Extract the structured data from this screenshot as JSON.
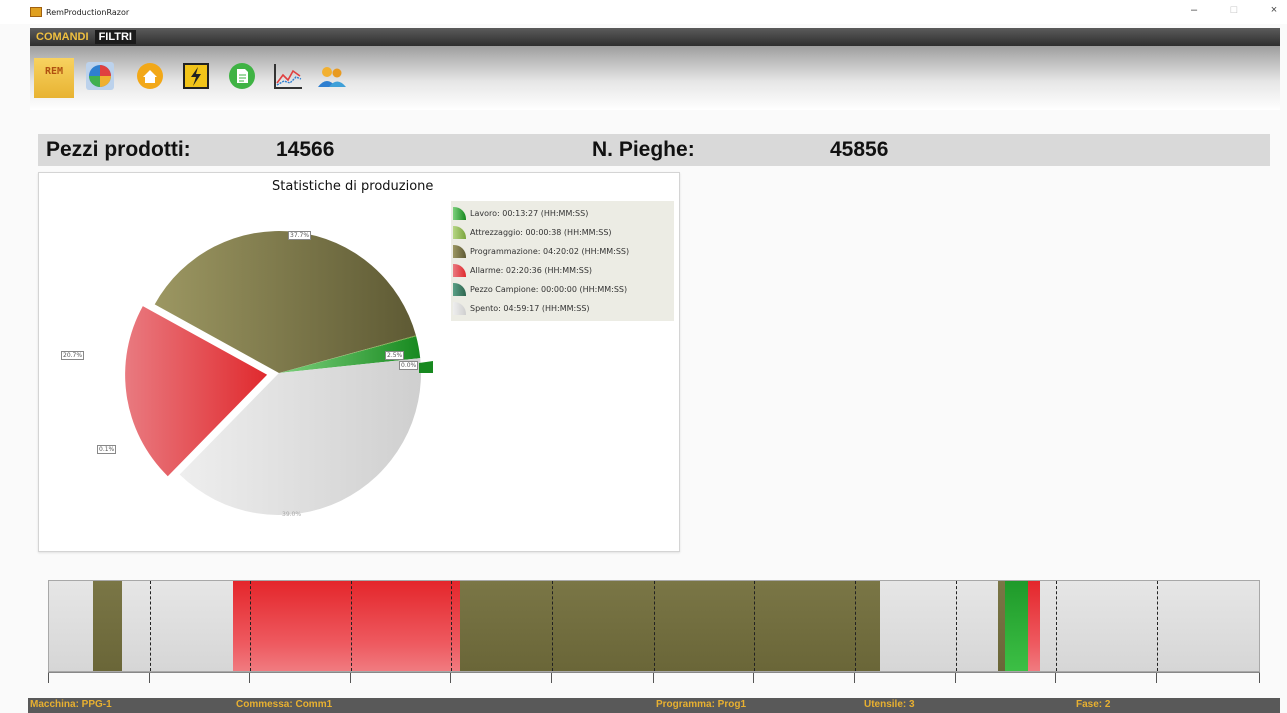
{
  "window": {
    "title": "RemProductionRazor"
  },
  "window_buttons": {
    "minimize": "‒",
    "maximize": "□",
    "close": "×"
  },
  "menu": {
    "items": [
      "COMANDI",
      "FILTRI"
    ]
  },
  "toolbar": {
    "rem_label": "REM",
    "icons": [
      "rem-icon",
      "pie-chart-icon",
      "home-icon",
      "lightning-icon",
      "document-icon",
      "line-chart-icon",
      "users-icon"
    ]
  },
  "stats": {
    "pieces_label": "Pezzi prodotti:",
    "pieces_value": "14566",
    "bends_label": "N. Pieghe:",
    "bends_value": "45856"
  },
  "chart_data": {
    "type": "pie",
    "title": "Statistiche di produzione",
    "legend_position": "top-right",
    "series": [
      {
        "name": "Lavoro: 00:13:27 (HH:MM:SS)",
        "value": 2.5,
        "color": "#2e9e3a"
      },
      {
        "name": "Attrezzaggio: 00:00:38 (HH:MM:SS)",
        "value": 0.1,
        "color": "#8fb84a"
      },
      {
        "name": "Programmazione: 04:20:02 (HH:MM:SS)",
        "value": 37.7,
        "color": "#7e7a48"
      },
      {
        "name": "Allarme: 02:20:36 (HH:MM:SS)",
        "value": 20.7,
        "color": "#e0393e"
      },
      {
        "name": "Pezzo Campione: 00:00:00 (HH:MM:SS)",
        "value": 0.0,
        "color": "#3f7a62"
      },
      {
        "name": "Spento: 04:59:17 (HH:MM:SS)",
        "value": 39.0,
        "color": "#dcdcdc"
      }
    ]
  },
  "timeline": {
    "segments": [
      {
        "from": 0.0,
        "to": 0.036,
        "state": "off"
      },
      {
        "from": 0.036,
        "to": 0.06,
        "state": "programming"
      },
      {
        "from": 0.06,
        "to": 0.152,
        "state": "off"
      },
      {
        "from": 0.152,
        "to": 0.339,
        "state": "alarm"
      },
      {
        "from": 0.339,
        "to": 0.686,
        "state": "programming"
      },
      {
        "from": 0.686,
        "to": 0.783,
        "state": "off"
      },
      {
        "from": 0.783,
        "to": 0.789,
        "state": "programming"
      },
      {
        "from": 0.789,
        "to": 0.808,
        "state": "work"
      },
      {
        "from": 0.808,
        "to": 0.818,
        "state": "alarm"
      },
      {
        "from": 0.818,
        "to": 1.0,
        "state": "off"
      }
    ],
    "dividers": [
      0.083,
      0.166,
      0.249,
      0.332,
      0.415,
      0.499,
      0.582,
      0.665,
      0.748,
      0.831,
      0.914
    ]
  },
  "status": {
    "machine": "Macchina: PPG-1",
    "order": "Commessa: Comm1",
    "program": "Programma: Prog1",
    "tool": "Utensile: 3",
    "phase": "Fase: 2"
  },
  "colors": {
    "status_text": "#e8b030",
    "menu_active": "#f0c040",
    "work": "#2e9e3a",
    "programming": "#7e7a48",
    "alarm": "#e0393e",
    "off": "#dcdcdc"
  }
}
